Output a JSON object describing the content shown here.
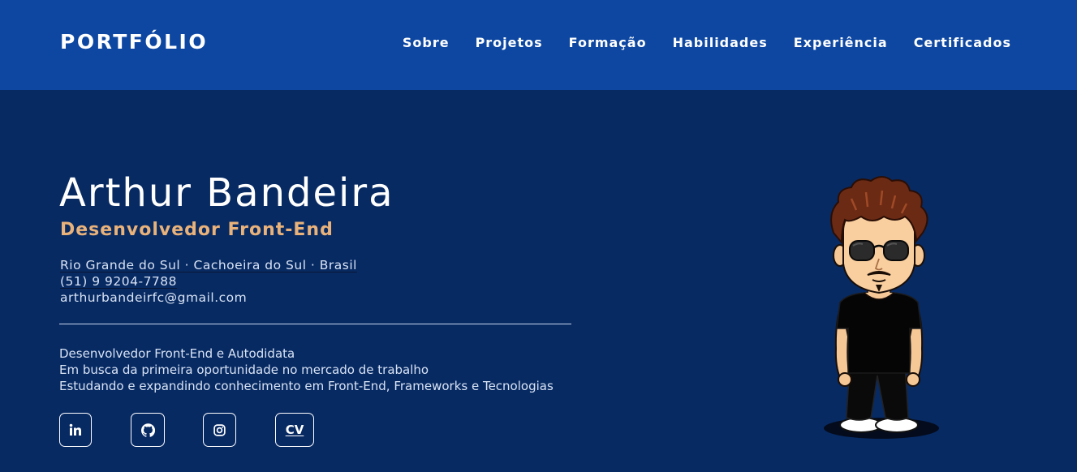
{
  "header": {
    "logo": "PORTFÓLIO",
    "nav": [
      {
        "label": "Sobre"
      },
      {
        "label": "Projetos"
      },
      {
        "label": "Formação"
      },
      {
        "label": "Habilidades"
      },
      {
        "label": "Experiência"
      },
      {
        "label": "Certificados"
      }
    ]
  },
  "hero": {
    "name": "Arthur Bandeira",
    "role": "Desenvolvedor Front-End",
    "location": "Rio Grande do Sul · Cachoeira do Sul · Brasil",
    "phone": "(51) 9 9204-7788",
    "email": "arthurbandeirfc@gmail.com",
    "bio": [
      "Desenvolvedor Front-End e Autodidata",
      "Em busca da primeira oportunidade no mercado de trabalho",
      "Estudando e expandindo conhecimento em Front-End, Frameworks e Tecnologias"
    ]
  },
  "social": {
    "links": [
      {
        "icon": "linkedin-icon"
      },
      {
        "icon": "github-icon"
      },
      {
        "icon": "instagram-icon"
      }
    ],
    "cv_label": "CV"
  },
  "colors": {
    "header_bg": "#0d47a1",
    "page_bg": "#072a63",
    "accent": "#e9b27a",
    "text": "#ffffff"
  }
}
